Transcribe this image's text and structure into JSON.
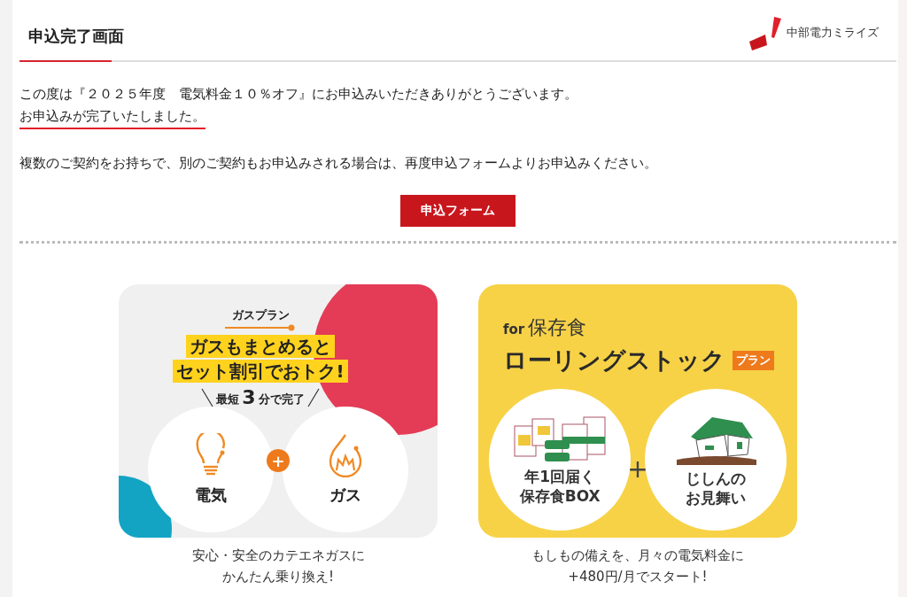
{
  "header": {
    "title": "申込完了画面",
    "logo_text": "中部電力ミライズ"
  },
  "message": {
    "lines": [
      {
        "text": "この度は『２０２５年度　電気料金１０％オフ』にお申込みいただきありがとうございます。",
        "underlined": false
      },
      {
        "text": "お申込みが完了いたしました。",
        "underlined": true
      }
    ],
    "note": "複数のご契約をお持ちで、別のご契約もお申込みされる場合は、再度申込フォームよりお申込みください。"
  },
  "form_button": {
    "label": "申込フォーム"
  },
  "banners": [
    {
      "kind": "gas",
      "tag": "ガスプラン",
      "headline": [
        "ガスもまとめると",
        "セット割引でおトク!"
      ],
      "time_prefix": "最短",
      "time_number": "3",
      "time_suffix": "分で完了",
      "plus": "+",
      "items": [
        {
          "kind": "bulb",
          "label": [
            "電気"
          ]
        },
        {
          "kind": "flame",
          "label": [
            "ガス"
          ]
        }
      ],
      "caption": [
        "安心・安全のカテエネガスに",
        "かんたん乗り換え!"
      ]
    },
    {
      "kind": "stock",
      "for_text": "for",
      "topic": "保存食",
      "title": "ローリングストック",
      "badge": "プラン",
      "plus": "+",
      "items": [
        {
          "kind": "cans",
          "label": [
            "年1回届く",
            "保存食BOX"
          ]
        },
        {
          "kind": "house",
          "label": [
            "じしんの",
            "お見舞い"
          ]
        }
      ],
      "caption": [
        "もしもの備えを、月々の電気料金に",
        "+480円/月でスタート!"
      ]
    }
  ]
}
